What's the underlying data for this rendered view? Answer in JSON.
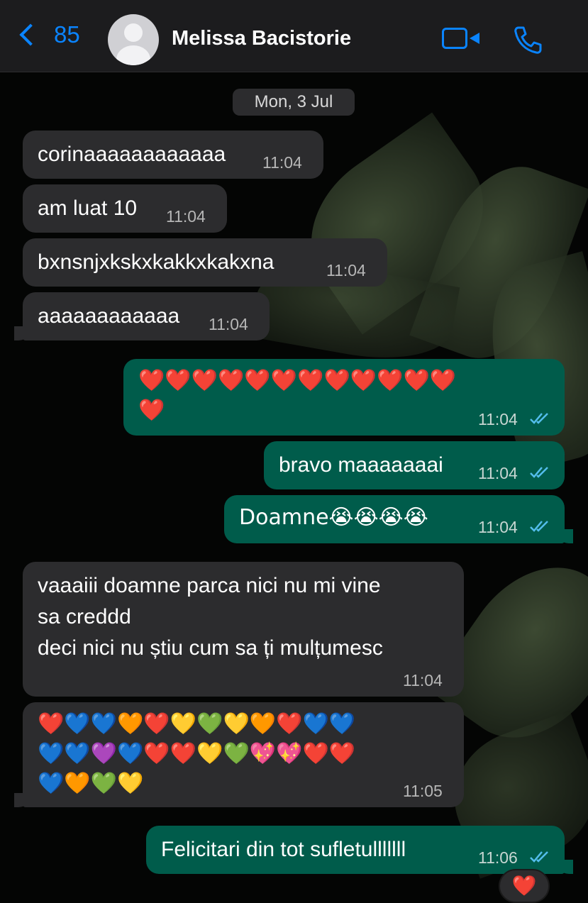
{
  "header": {
    "back_count": "85",
    "contact_name": "Melissa Bacistorie",
    "video_icon": "video-camera-icon",
    "call_icon": "phone-icon",
    "back_icon": "chevron-left-icon",
    "avatar_icon": "default-avatar-icon"
  },
  "date_separator": "Mon, 3 Jul",
  "messages": [
    {
      "dir": "in",
      "text": "corinaaaaaaaaaaaa",
      "time": "11:04"
    },
    {
      "dir": "in",
      "text": "am luat 10",
      "time": "11:04"
    },
    {
      "dir": "in",
      "text": "bxnsnjxkskxkakkxkakxna",
      "time": "11:04"
    },
    {
      "dir": "in",
      "text": "aaaaaaaaaaaa",
      "time": "11:04"
    },
    {
      "dir": "out",
      "text": "❤️❤️❤️❤️❤️❤️❤️❤️❤️❤️❤️❤️\n❤️",
      "time": "11:04",
      "status": "read"
    },
    {
      "dir": "out",
      "text": "bravo maaaaaaai",
      "time": "11:04",
      "status": "read"
    },
    {
      "dir": "out",
      "text": "Doamne😭😭😭😭",
      "time": "11:04",
      "status": "read"
    },
    {
      "dir": "in",
      "text": "vaaaiii doamne parca nici nu mi vine\nsa creddd\ndeci nici nu știu cum sa ți mulțumesc",
      "time": "11:04"
    },
    {
      "dir": "in",
      "text": "❤️💙💙🧡❤️💛💚💛🧡❤️💙💙\n💙💙💜💙❤️❤️💛💚💖💖❤️❤️\n💙🧡💚💛",
      "time": "11:05"
    },
    {
      "dir": "out",
      "text": "Felicitari din tot sufletulllllll",
      "time": "11:06",
      "status": "read",
      "reaction": "❤️"
    }
  ],
  "colors": {
    "incoming_bubble": "#2c2c2e",
    "outgoing_bubble": "#005c4b",
    "accent": "#0a84ff",
    "read_tick": "#53bdeb"
  }
}
